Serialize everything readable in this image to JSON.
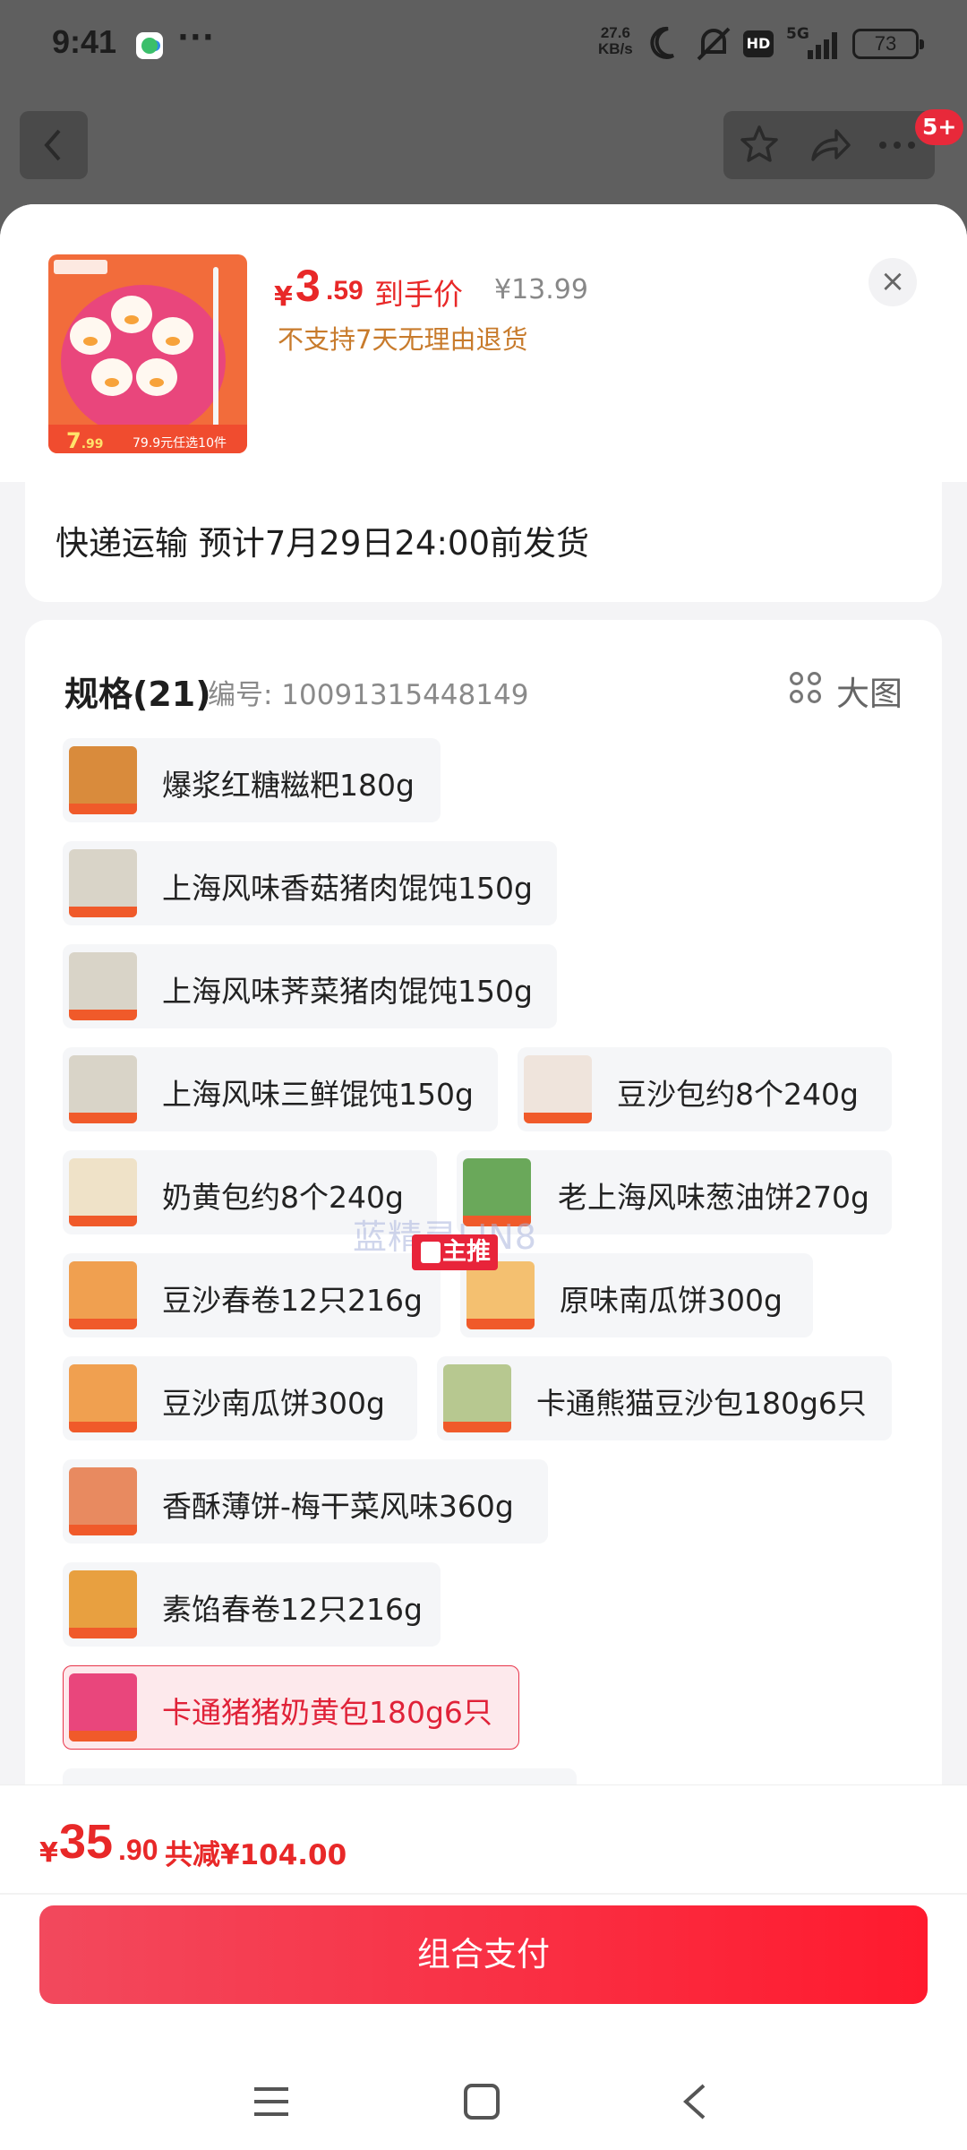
{
  "status_bar": {
    "time": "9:41",
    "more": "···",
    "net_speed_value": "27.6",
    "net_speed_unit": "KB/s",
    "hd": "HD",
    "network": "5G",
    "battery": "73"
  },
  "nav": {
    "badge": "5+"
  },
  "product": {
    "price_currency": "¥",
    "price_integer": "3",
    "price_decimal": ".59",
    "price_label": "到手价",
    "original_price": "¥13.99",
    "return_policy": "不支持7天无理由退货",
    "thumb_price": "7",
    "thumb_price_dec": ".99",
    "thumb_slogan": "79.9元任选10件",
    "close": "×"
  },
  "shipping": {
    "text": "快递运输 预计7月29日24:00前发货"
  },
  "spec": {
    "title": "规格(21)",
    "code": "编号: 10091315448149",
    "big_view": "大图",
    "main_tag": "主推",
    "watermark": "蓝精灵LIN8",
    "options": [
      {
        "label": "爆浆红糖糍粑180g",
        "selected": false
      },
      {
        "label": "上海风味香菇猪肉馄饨150g",
        "selected": false
      },
      {
        "label": "上海风味荠菜猪肉馄饨150g",
        "selected": false
      },
      {
        "label": "上海风味三鲜馄饨150g",
        "selected": false
      },
      {
        "label": "豆沙包约8个240g",
        "selected": false
      },
      {
        "label": "奶黄包约8个240g",
        "selected": false
      },
      {
        "label": "老上海风味葱油饼270g",
        "selected": false
      },
      {
        "label": "豆沙春卷12只216g",
        "selected": false
      },
      {
        "label": "原味南瓜饼300g",
        "selected": false
      },
      {
        "label": "豆沙南瓜饼300g",
        "selected": false
      },
      {
        "label": "卡通熊猫豆沙包180g6只",
        "selected": false
      },
      {
        "label": "香酥薄饼-梅干菜风味360g",
        "selected": false
      },
      {
        "label": "素馅春卷12只216g",
        "selected": false
      },
      {
        "label": "卡通猪猪奶黄包180g6只",
        "selected": true
      }
    ]
  },
  "footer": {
    "total_currency": "¥",
    "total_integer": "35",
    "total_decimal": ".90",
    "saved": "共减¥104.00",
    "pay_button": "组合支付"
  },
  "colors": {
    "accent": "#e82828",
    "selected_bg": "#fde9ec",
    "return_policy": "#c87b2c"
  }
}
